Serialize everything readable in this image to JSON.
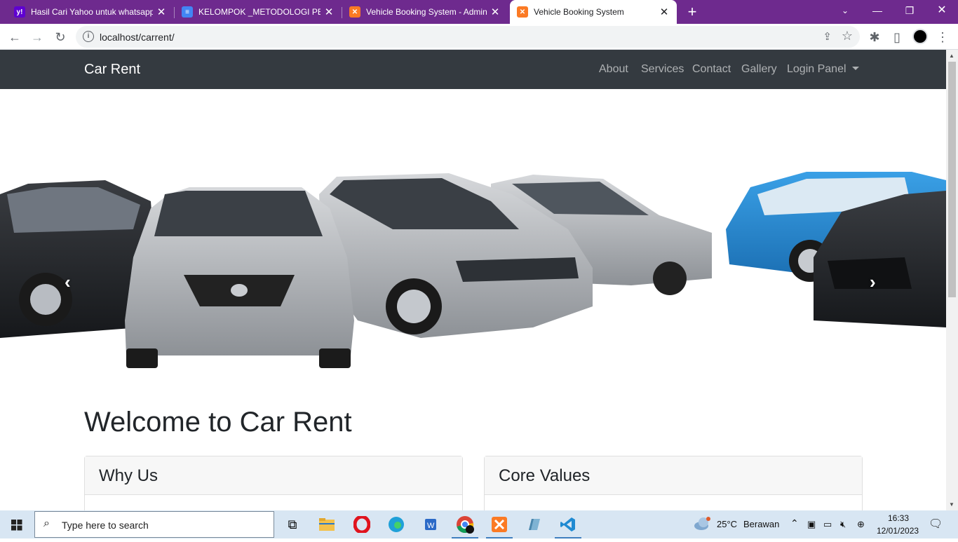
{
  "browser": {
    "tabs": [
      {
        "title": "Hasil Cari Yahoo untuk whatsapp",
        "active": false
      },
      {
        "title": "KELOMPOK _METODOLOGI PENGEMBANGAN",
        "active": false
      },
      {
        "title": "Vehicle Booking System - Admin",
        "active": false
      },
      {
        "title": "Vehicle Booking System",
        "active": true
      }
    ],
    "url": "localhost/carrent/"
  },
  "navbar": {
    "brand": "Car Rent",
    "links": [
      "About",
      "Services",
      "Contact",
      "Gallery"
    ],
    "dropdown": "Login Panel"
  },
  "hero": {
    "prev_icon": "chevron-left-icon",
    "next_icon": "chevron-right-icon"
  },
  "main": {
    "heading": "Welcome to Car Rent",
    "cards": [
      {
        "title": "Why Us"
      },
      {
        "title": "Core Values"
      }
    ]
  },
  "taskbar": {
    "search_placeholder": "Type here to search",
    "weather": {
      "temp": "25°C",
      "desc": "Berawan"
    },
    "time": "16:33",
    "date": "12/01/2023"
  },
  "colors": {
    "tabstrip": "#6e2a8e",
    "navbar": "#343a40",
    "accent": "#3f7fbf"
  }
}
